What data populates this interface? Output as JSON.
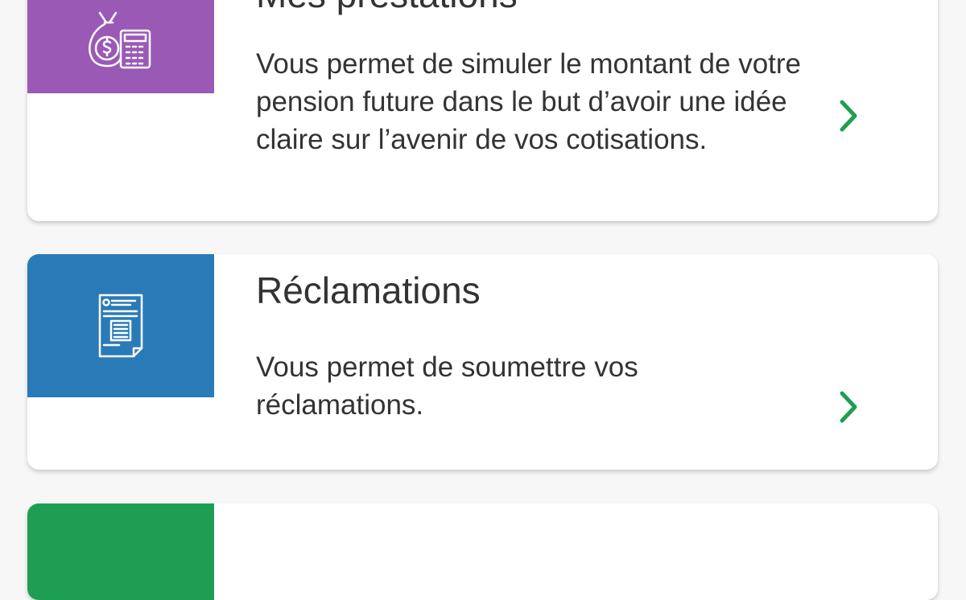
{
  "colors": {
    "simulation_tile": "#9b59b6",
    "reclamations_tile": "#2a7ab8",
    "third_tile": "#1e9e52",
    "chevron": "#1e9e52",
    "background": "#f7f7f7",
    "text": "#333333"
  },
  "cards": [
    {
      "title": "Mes prestations",
      "icon": "money-bag-calculator-icon",
      "description": "Vous permet de simuler le montant de votre pension future dans le but d’avoir une idée claire sur l’avenir de vos cotisations.",
      "chevron_icon": "chevron-right-icon"
    },
    {
      "title": "Réclamations",
      "icon": "document-form-icon",
      "description": "Vous permet de soumettre vos réclamations.",
      "chevron_icon": "chevron-right-icon"
    },
    {
      "icon": "green-tile"
    }
  ]
}
